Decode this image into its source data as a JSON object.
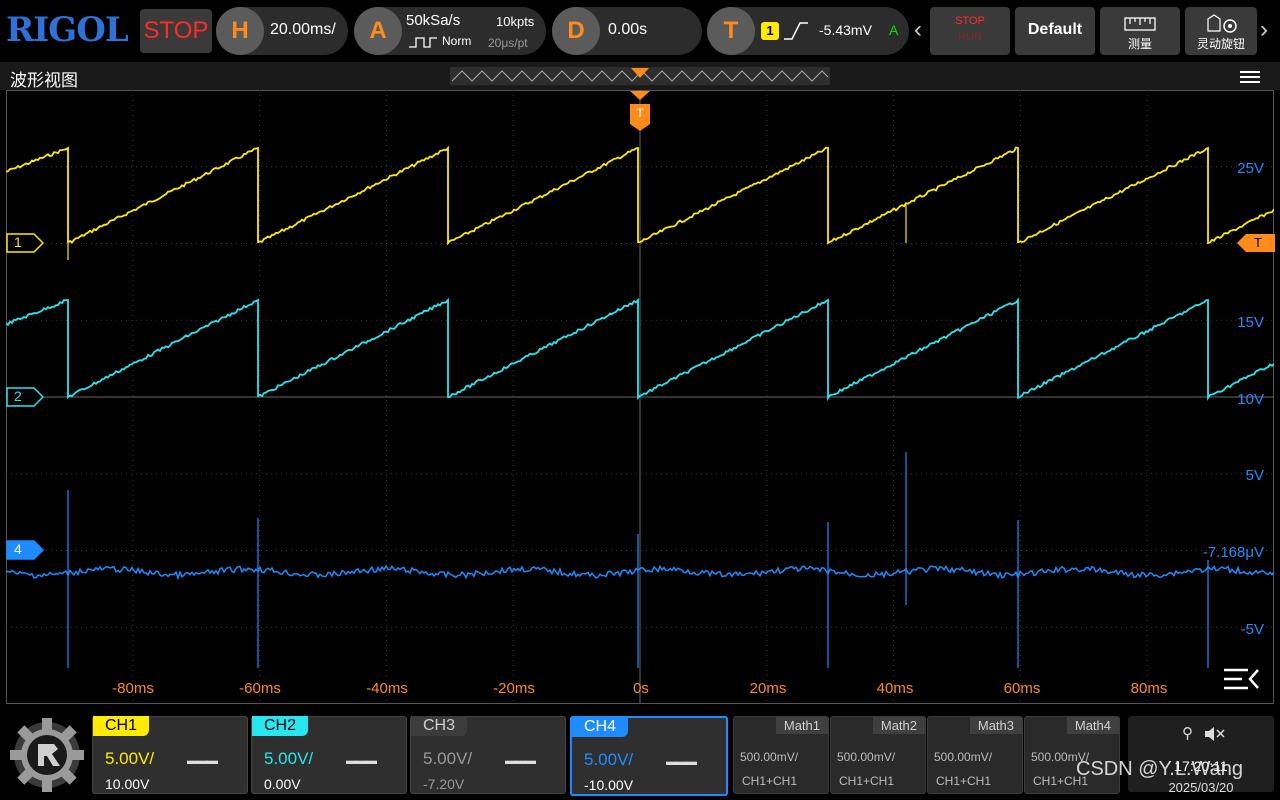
{
  "top": {
    "logo": "RIGOL",
    "status": "STOP",
    "horizontal": {
      "letter": "H",
      "scale": "20.00ms/"
    },
    "acquire": {
      "letter": "A",
      "rate": "50kSa/s",
      "depth": "10kpts",
      "mode": "Norm",
      "interval": "20μs/pt"
    },
    "delay": {
      "letter": "D",
      "value": "0.00s"
    },
    "trigger": {
      "letter": "T",
      "source": "1",
      "level": "-5.43mV",
      "mode": "A"
    },
    "buttons": {
      "stop_run_top": "STOP",
      "stop_run_bottom": "RUN",
      "default": "Default",
      "measure": "测量",
      "knob": "灵动旋钮"
    }
  },
  "wave": {
    "title": "波形视图",
    "trigger_marker": "T",
    "markers": {
      "ch1": "1",
      "ch2": "2",
      "ch4": "4",
      "trig": "T"
    },
    "right_labels": {
      "ch1": "25V",
      "ch2_top": "15V",
      "ch2_bottom": "10V",
      "ch4_top": "5V",
      "ch4_mid": "-7.168μV",
      "ch4_bottom": "-5V"
    },
    "time_labels": [
      "-80ms",
      "-60ms",
      "-40ms",
      "-20ms",
      "0s",
      "20ms",
      "40ms",
      "60ms",
      "80ms"
    ]
  },
  "colors": {
    "ch1": "#ffea00",
    "ch2": "#28e6f0",
    "ch3": "#9a9a9a",
    "ch4": "#1e8cff",
    "orange": "#ff8c1a"
  },
  "channels": [
    {
      "name": "CH1",
      "scale": "5.00V/",
      "offset": "10.00V"
    },
    {
      "name": "CH2",
      "scale": "5.00V/",
      "offset": "0.00V"
    },
    {
      "name": "CH3",
      "scale": "5.00V/",
      "offset": "-7.20V"
    },
    {
      "name": "CH4",
      "scale": "5.00V/",
      "offset": "-10.00V"
    }
  ],
  "math": [
    {
      "name": "Math1",
      "scale": "500.00mV/",
      "source": "CH1+CH1"
    },
    {
      "name": "Math2",
      "scale": "500.00mV/",
      "source": "CH1+CH1"
    },
    {
      "name": "Math3",
      "scale": "500.00mV/",
      "source": "CH1+CH1"
    },
    {
      "name": "Math4",
      "scale": "500.00mV/",
      "source": "CH1+CH1"
    }
  ],
  "status": {
    "time": "17:20:11",
    "date": "2025/03/20"
  },
  "watermark": "CSDN @Y.L.Wang"
}
